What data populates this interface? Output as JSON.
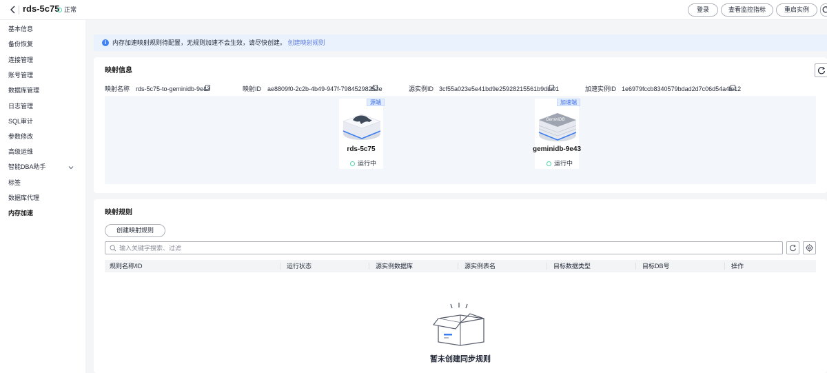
{
  "header": {
    "title": "rds-5c75",
    "status": "正常",
    "buttons": [
      "登录",
      "查看监控指标",
      "重启实例"
    ],
    "status_color": "#50d4ab"
  },
  "sidebar": {
    "items": [
      {
        "label": "基本信息"
      },
      {
        "label": "备份恢复"
      },
      {
        "label": "连接管理"
      },
      {
        "label": "账号管理"
      },
      {
        "label": "数据库管理"
      },
      {
        "label": "日志管理"
      },
      {
        "label": "SQL审计"
      },
      {
        "label": "参数修改"
      },
      {
        "label": "高级运维"
      },
      {
        "label": "智能DBA助手",
        "expandable": true
      },
      {
        "label": "标签"
      },
      {
        "label": "数据库代理"
      },
      {
        "label": "内存加速",
        "active": true
      }
    ]
  },
  "notice": {
    "text": "内存加速映射规则待配置，无规则加速不会生效，请尽快创建。",
    "link": "创建映射规则"
  },
  "mapping_info": {
    "title": "映射信息",
    "fields": [
      {
        "label": "映射名称",
        "value": "rds-5c75-to-geminidb-9e43"
      },
      {
        "label": "映射ID",
        "value": "ae8809f0-2c2b-4b49-947f-79845298253e"
      },
      {
        "label": "源实例ID",
        "value": "3cf55a023e5e41bd9e25928215561b9din01"
      },
      {
        "label": "加速实例ID",
        "value": "1e6979fccb8340579bdad2d7c06d54a4in12"
      }
    ],
    "source_node": {
      "tag": "源端",
      "name": "rds-5c75",
      "status": "运行中"
    },
    "target_node": {
      "tag": "加速端",
      "name": "geminidb-9e43",
      "status": "运行中",
      "logo_text": "GeminiDB"
    }
  },
  "mapping_rules": {
    "title": "映射规则",
    "create_button": "创建映射规则",
    "search_placeholder": "输入关键字搜索、过滤",
    "columns": [
      "规则名称/ID",
      "运行状态",
      "源实例数据库",
      "源实例表名",
      "目标数据类型",
      "目标DB号",
      "操作"
    ],
    "empty_text": "暂未创建同步规则"
  },
  "colors": {
    "accent": "#5e7ce0",
    "info_bg": "#eaf2fe",
    "running": "#50d4ab"
  }
}
